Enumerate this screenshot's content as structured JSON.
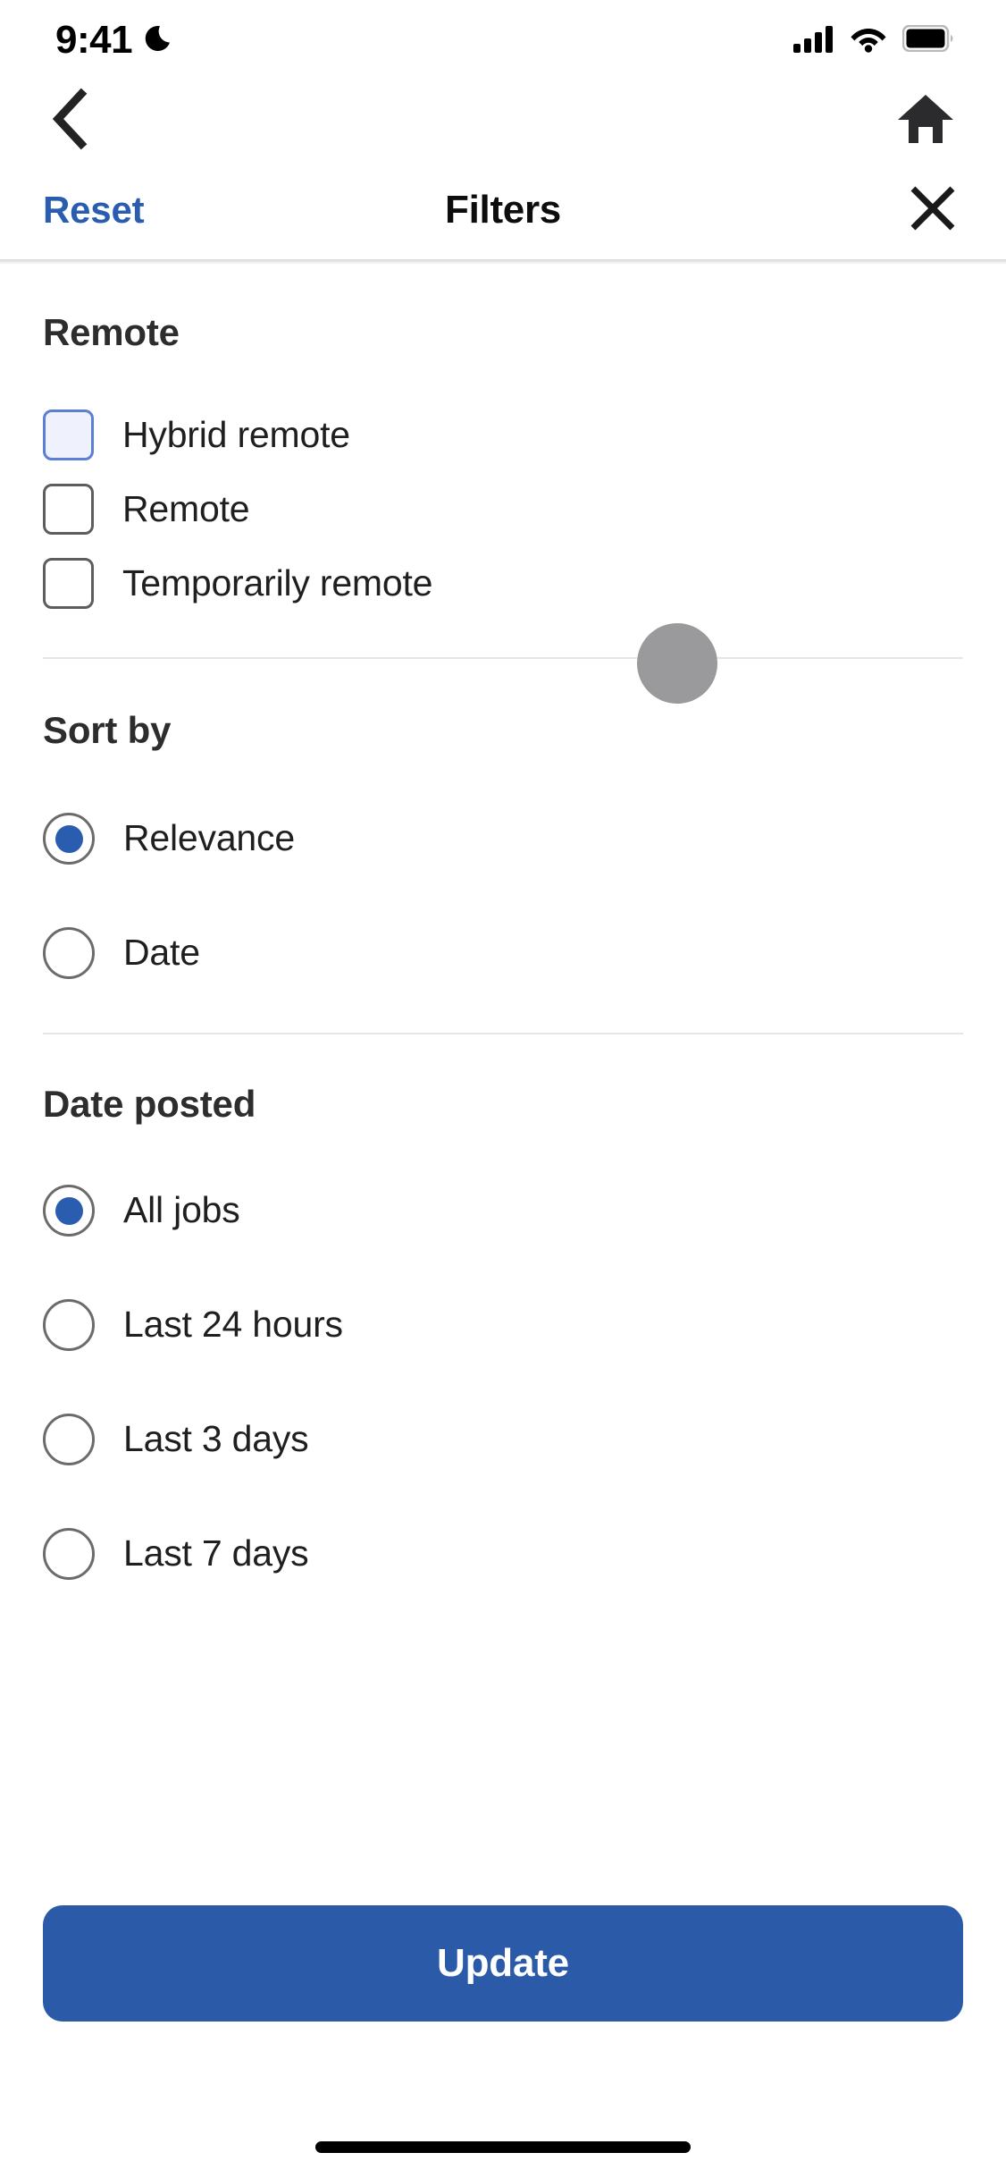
{
  "status_bar": {
    "time": "9:41",
    "dnd_icon": "crescent-moon-icon",
    "signal_icon": "cellular-signal-icon",
    "wifi_icon": "wifi-icon",
    "battery_icon": "battery-full-icon"
  },
  "nav": {
    "back_icon": "chevron-left-icon",
    "home_icon": "home-icon"
  },
  "header": {
    "reset_label": "Reset",
    "title": "Filters",
    "close_icon": "close-x-icon"
  },
  "colors": {
    "accent_blue": "#2a5db0",
    "button_blue": "#2b5aa8",
    "focus_border": "#5b7fd4",
    "focus_fill": "#eff1fc",
    "touch_indicator": "#9a9a9d",
    "divider": "#e4e6e8",
    "text_primary": "#1f1f1f",
    "heading": "#2d2d2d"
  },
  "sections": [
    {
      "id": "remote",
      "title": "Remote",
      "control": "checkbox",
      "options": [
        {
          "label": "Hybrid remote",
          "checked": false,
          "focused": true
        },
        {
          "label": "Remote",
          "checked": false,
          "focused": false
        },
        {
          "label": "Temporarily remote",
          "checked": false,
          "focused": false
        }
      ]
    },
    {
      "id": "sort-by",
      "title": "Sort by",
      "control": "radio",
      "options": [
        {
          "label": "Relevance",
          "checked": true,
          "focused": false
        },
        {
          "label": "Date",
          "checked": false,
          "focused": false
        }
      ]
    },
    {
      "id": "date-posted",
      "title": "Date posted",
      "control": "radio",
      "options": [
        {
          "label": "All jobs",
          "checked": true,
          "focused": false
        },
        {
          "label": "Last 24 hours",
          "checked": false,
          "focused": false
        },
        {
          "label": "Last 3 days",
          "checked": false,
          "focused": false
        },
        {
          "label": "Last 7 days",
          "checked": false,
          "focused": false
        }
      ]
    }
  ],
  "footer": {
    "update_label": "Update"
  }
}
